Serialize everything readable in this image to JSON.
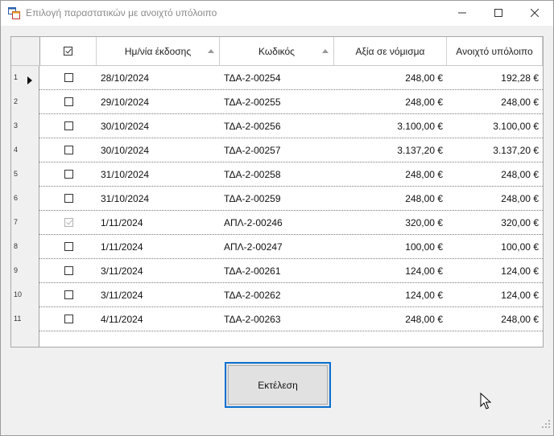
{
  "window": {
    "title": "Επιλογή παραστατικών με ανοιχτό υπόλοιπο"
  },
  "grid": {
    "columns": [
      {
        "key": "select",
        "label": ""
      },
      {
        "key": "date",
        "label": "Ημ/νία έκδοσης"
      },
      {
        "key": "code",
        "label": "Κωδικός"
      },
      {
        "key": "value",
        "label": "Αξία σε νόμισμα"
      },
      {
        "key": "balance",
        "label": "Ανοιχτό υπόλοιπο"
      }
    ],
    "header_checked": true,
    "rows": [
      {
        "num": "1",
        "checked": false,
        "disabled": false,
        "current": true,
        "date": "28/10/2024",
        "code": "ΤΔΑ-2-00254",
        "value": "248,00 €",
        "balance": "192,28 €"
      },
      {
        "num": "2",
        "checked": false,
        "disabled": false,
        "current": false,
        "date": "29/10/2024",
        "code": "ΤΔΑ-2-00255",
        "value": "248,00 €",
        "balance": "248,00 €"
      },
      {
        "num": "3",
        "checked": false,
        "disabled": false,
        "current": false,
        "date": "30/10/2024",
        "code": "ΤΔΑ-2-00256",
        "value": "3.100,00 €",
        "balance": "3.100,00 €"
      },
      {
        "num": "4",
        "checked": false,
        "disabled": false,
        "current": false,
        "date": "30/10/2024",
        "code": "ΤΔΑ-2-00257",
        "value": "3.137,20 €",
        "balance": "3.137,20 €"
      },
      {
        "num": "5",
        "checked": false,
        "disabled": false,
        "current": false,
        "date": "31/10/2024",
        "code": "ΤΔΑ-2-00258",
        "value": "248,00 €",
        "balance": "248,00 €"
      },
      {
        "num": "6",
        "checked": false,
        "disabled": false,
        "current": false,
        "date": "31/10/2024",
        "code": "ΤΔΑ-2-00259",
        "value": "248,00 €",
        "balance": "248,00 €"
      },
      {
        "num": "7",
        "checked": true,
        "disabled": true,
        "current": false,
        "date": "1/11/2024",
        "code": "ΑΠΛ-2-00246",
        "value": "320,00 €",
        "balance": "320,00 €"
      },
      {
        "num": "8",
        "checked": false,
        "disabled": false,
        "current": false,
        "date": "1/11/2024",
        "code": "ΑΠΛ-2-00247",
        "value": "100,00 €",
        "balance": "100,00 €"
      },
      {
        "num": "9",
        "checked": false,
        "disabled": false,
        "current": false,
        "date": "3/11/2024",
        "code": "ΤΔΑ-2-00261",
        "value": "124,00 €",
        "balance": "124,00 €"
      },
      {
        "num": "10",
        "checked": false,
        "disabled": false,
        "current": false,
        "date": "3/11/2024",
        "code": "ΤΔΑ-2-00262",
        "value": "124,00 €",
        "balance": "124,00 €"
      },
      {
        "num": "11",
        "checked": false,
        "disabled": false,
        "current": false,
        "date": "4/11/2024",
        "code": "ΤΔΑ-2-00263",
        "value": "248,00 €",
        "balance": "248,00 €"
      }
    ]
  },
  "actions": {
    "run_label": "Εκτέλεση"
  },
  "icons": {
    "app": "app-forms-icon",
    "minimize": "minimize-icon",
    "maximize": "maximize-icon",
    "close": "close-icon",
    "row_current": "row-pointer-icon",
    "cursor": "mouse-pointer-icon",
    "grip": "resize-grip-icon"
  }
}
